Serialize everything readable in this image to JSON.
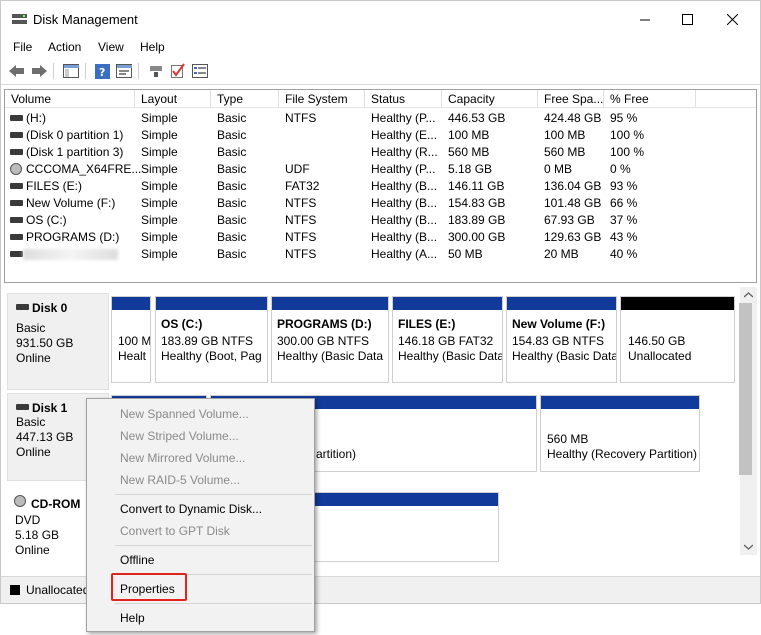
{
  "window": {
    "title": "Disk Management"
  },
  "menu": [
    "File",
    "Action",
    "View",
    "Help"
  ],
  "toolbar": {
    "icons": [
      "back-arrow-icon",
      "forward-arrow-icon",
      "show-hide-console-tree-icon",
      "help-icon",
      "properties-icon",
      "connect-icon",
      "check-icon",
      "list-icon"
    ]
  },
  "volumes": {
    "columns": [
      "Volume",
      "Layout",
      "Type",
      "File System",
      "Status",
      "Capacity",
      "Free Spa...",
      "% Free"
    ],
    "rows": [
      {
        "volume": "(H:)",
        "layout": "Simple",
        "type": "Basic",
        "fs": "NTFS",
        "status": "Healthy (P...",
        "capacity": "446.53 GB",
        "free": "424.48 GB",
        "pct": "95 %"
      },
      {
        "volume": "(Disk 0 partition 1)",
        "layout": "Simple",
        "type": "Basic",
        "fs": "",
        "status": "Healthy (E...",
        "capacity": "100 MB",
        "free": "100 MB",
        "pct": "100 %"
      },
      {
        "volume": "(Disk 1 partition 3)",
        "layout": "Simple",
        "type": "Basic",
        "fs": "",
        "status": "Healthy (R...",
        "capacity": "560 MB",
        "free": "560 MB",
        "pct": "100 %"
      },
      {
        "volume": "CCCOMA_X64FRE...",
        "layout": "Simple",
        "type": "Basic",
        "fs": "UDF",
        "status": "Healthy (P...",
        "capacity": "5.18 GB",
        "free": "0 MB",
        "pct": "0 %"
      },
      {
        "volume": "FILES (E:)",
        "layout": "Simple",
        "type": "Basic",
        "fs": "FAT32",
        "status": "Healthy (B...",
        "capacity": "146.11 GB",
        "free": "136.04 GB",
        "pct": "93 %"
      },
      {
        "volume": "New Volume (F:)",
        "layout": "Simple",
        "type": "Basic",
        "fs": "NTFS",
        "status": "Healthy (B...",
        "capacity": "154.83 GB",
        "free": "101.48 GB",
        "pct": "66 %"
      },
      {
        "volume": "OS (C:)",
        "layout": "Simple",
        "type": "Basic",
        "fs": "NTFS",
        "status": "Healthy (B...",
        "capacity": "183.89 GB",
        "free": "67.93 GB",
        "pct": "37 %"
      },
      {
        "volume": "PROGRAMS (D:)",
        "layout": "Simple",
        "type": "Basic",
        "fs": "NTFS",
        "status": "Healthy (B...",
        "capacity": "300.00 GB",
        "free": "129.63 GB",
        "pct": "43 %"
      },
      {
        "volume": "",
        "layout": "Simple",
        "type": "Basic",
        "fs": "NTFS",
        "status": "Healthy (A...",
        "capacity": "50 MB",
        "free": "20 MB",
        "pct": "40 %"
      }
    ]
  },
  "disk0": {
    "name": "Disk 0",
    "kind": "Basic",
    "size": "931.50 GB",
    "state": "Online",
    "partitions": [
      {
        "name": "",
        "size": "100 M",
        "status": "Healt"
      },
      {
        "name": "OS  (C:)",
        "size": "183.89 GB NTFS",
        "status": "Healthy (Boot, Pag"
      },
      {
        "name": "PROGRAMS  (D:)",
        "size": "300.00 GB NTFS",
        "status": "Healthy (Basic Data"
      },
      {
        "name": "FILES  (E:)",
        "size": "146.18 GB FAT32",
        "status": "Healthy (Basic Data"
      },
      {
        "name": "New Volume  (F:)",
        "size": "154.83 GB NTFS",
        "status": "Healthy (Basic Data"
      },
      {
        "name": "",
        "size": "146.50 GB",
        "status": "Unallocated"
      }
    ]
  },
  "disk1": {
    "name": "Disk 1",
    "kind": "Basic",
    "size": "447.13 GB",
    "state": "Online",
    "partitions": [
      {
        "status": "artition)"
      },
      {
        "size": "560 MB",
        "status": "Healthy (Recovery Partition)"
      }
    ]
  },
  "cdrom": {
    "name": "CD-ROM",
    "kind": "DVD",
    "size": "5.18 GB",
    "state": "Online"
  },
  "legend": {
    "unallocated": "Unallocated"
  },
  "context_menu": {
    "new_spanned": "New Spanned Volume...",
    "new_striped": "New Striped Volume...",
    "new_mirrored": "New Mirrored Volume...",
    "new_raid5": "New RAID-5 Volume...",
    "convert_dynamic": "Convert to Dynamic Disk...",
    "convert_gpt": "Convert to GPT Disk",
    "offline": "Offline",
    "properties": "Properties",
    "help": "Help"
  },
  "colors": {
    "primary_partition": "#123a9b",
    "unallocated": "#000000",
    "highlight": "#e0261c"
  }
}
